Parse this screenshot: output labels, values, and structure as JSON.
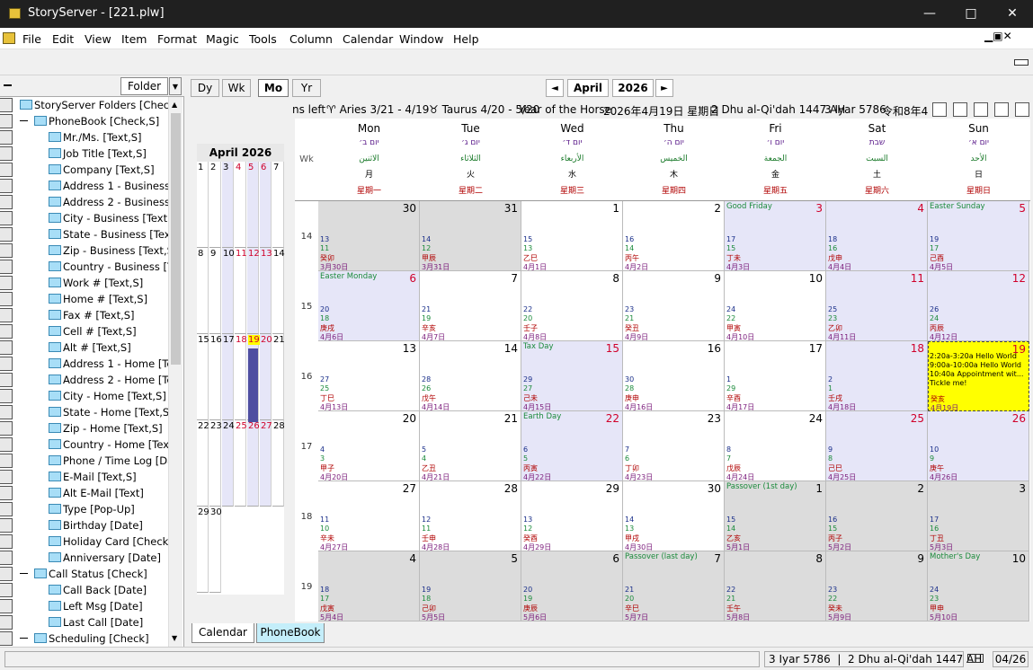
{
  "window": {
    "title": "StoryServer - [221.plw]"
  },
  "menu": [
    "File",
    "Edit",
    "View",
    "Item",
    "Format",
    "Magic",
    "Tools",
    "Column",
    "Calendar",
    "Window",
    "Help"
  ],
  "folder": {
    "header": "Folder",
    "items": [
      {
        "label": "StoryServer Folders [Check,S]",
        "level": 0,
        "minus": false
      },
      {
        "label": "PhoneBook [Check,S]",
        "level": 1,
        "minus": true
      },
      {
        "label": "Mr./Ms. [Text,S]",
        "level": 2
      },
      {
        "label": "Job Title [Text,S]",
        "level": 2
      },
      {
        "label": "Company [Text,S]",
        "level": 2
      },
      {
        "label": "Address 1 - Business [T",
        "level": 2
      },
      {
        "label": "Address 2 - Business [T",
        "level": 2
      },
      {
        "label": "City - Business [Text,S]",
        "level": 2
      },
      {
        "label": "State - Business [Text,S",
        "level": 2
      },
      {
        "label": "Zip - Business [Text,S]",
        "level": 2
      },
      {
        "label": "Country - Business [Tex",
        "level": 2
      },
      {
        "label": "Work # [Text,S]",
        "level": 2
      },
      {
        "label": "Home # [Text,S]",
        "level": 2
      },
      {
        "label": "Fax # [Text,S]",
        "level": 2
      },
      {
        "label": "Cell # [Text,S]",
        "level": 2
      },
      {
        "label": "Alt # [Text,S]",
        "level": 2
      },
      {
        "label": "Address 1 - Home [Text",
        "level": 2
      },
      {
        "label": "Address 2 - Home [Text",
        "level": 2
      },
      {
        "label": "City - Home [Text,S]",
        "level": 2
      },
      {
        "label": "State - Home [Text,S]",
        "level": 2
      },
      {
        "label": "Zip - Home [Text,S]",
        "level": 2
      },
      {
        "label": "Country - Home [Text,S]",
        "level": 2
      },
      {
        "label": "Phone / Time Log [Date,S",
        "level": 2
      },
      {
        "label": "E-Mail [Text,S]",
        "level": 2
      },
      {
        "label": "Alt E-Mail [Text]",
        "level": 2
      },
      {
        "label": "Type [Pop-Up]",
        "level": 2
      },
      {
        "label": "Birthday [Date]",
        "level": 2
      },
      {
        "label": "Holiday Card [Check]",
        "level": 2
      },
      {
        "label": "Anniversary [Date]",
        "level": 2
      },
      {
        "label": "Call Status [Check]",
        "level": 1,
        "minus": true
      },
      {
        "label": "Call Back [Date]",
        "level": 2
      },
      {
        "label": "Left Msg [Date]",
        "level": 2
      },
      {
        "label": "Last Call [Date]",
        "level": 2
      },
      {
        "label": "Scheduling [Check]",
        "level": 1,
        "minus": true
      }
    ]
  },
  "viewtabs": [
    "Dy",
    "Wk",
    "Mo",
    "Yr"
  ],
  "nav": {
    "month": "April",
    "year": "2026",
    "prev": "◄",
    "next": "►"
  },
  "infoline": {
    "left": "ns left",
    "aries": "♈ Aries 3/21 - 4/19",
    "taurus": "♉ Taurus 4/20 - 5/20",
    "horse": "Year of the Horse",
    "cn": "2026年4月19日 星期日",
    "hijri": "2 Dhu al-Qi'dah 1447 AH",
    "hebrew": "3 Iyar 5786",
    "jp": "令和8年4"
  },
  "mini": {
    "title": "April 2026",
    "rows": [
      [
        "1",
        "2",
        "3",
        "4",
        "5",
        "6",
        "7"
      ],
      [
        "8",
        "9",
        "10",
        "11",
        "12",
        "13",
        "14"
      ],
      [
        "15",
        "16",
        "17",
        "18",
        "19",
        "20",
        "21"
      ],
      [
        "22",
        "23",
        "24",
        "25",
        "26",
        "27",
        "28"
      ],
      [
        "29",
        "30",
        "",
        "",
        "",
        "",
        ""
      ]
    ]
  },
  "wk_label": "Wk",
  "weekdays": [
    {
      "en": "Mon",
      "heb": "יום ב׳",
      "ar": "الاثنين",
      "cn": "月",
      "cn2": "星期一"
    },
    {
      "en": "Tue",
      "heb": "יום ג׳",
      "ar": "الثلاثاء",
      "cn": "火",
      "cn2": "星期二"
    },
    {
      "en": "Wed",
      "heb": "יום ד׳",
      "ar": "الأربعاء",
      "cn": "水",
      "cn2": "星期三"
    },
    {
      "en": "Thu",
      "heb": "יום ה׳",
      "ar": "الخميس",
      "cn": "木",
      "cn2": "星期四"
    },
    {
      "en": "Fri",
      "heb": "יום ו׳",
      "ar": "الجمعة",
      "cn": "金",
      "cn2": "星期五"
    },
    {
      "en": "Sat",
      "heb": "שבת",
      "ar": "السبت",
      "cn": "土",
      "cn2": "星期六"
    },
    {
      "en": "Sun",
      "heb": "יום א׳",
      "ar": "الأحد",
      "cn": "日",
      "cn2": "星期日"
    }
  ],
  "weeks": [
    {
      "wk": "14",
      "days": [
        {
          "n": "30",
          "bg": "grey",
          "l1": "13",
          "l2": "11",
          "l3": "癸卯",
          "l4": "3月30日"
        },
        {
          "n": "31",
          "bg": "grey",
          "l1": "14",
          "l2": "12",
          "l3": "甲辰",
          "l4": "3月31日"
        },
        {
          "n": "1",
          "l1": "15",
          "l2": "13",
          "l3": "乙巳",
          "l4": "4月1日"
        },
        {
          "n": "2",
          "l1": "16",
          "l2": "14",
          "l3": "丙午",
          "l4": "4月2日"
        },
        {
          "n": "3",
          "bg": "blue",
          "red": true,
          "hol": "Good Friday",
          "l1": "17",
          "l2": "15",
          "l3": "丁未",
          "l4": "4月3日"
        },
        {
          "n": "4",
          "bg": "blue",
          "red": true,
          "l1": "18",
          "l2": "16",
          "l3": "戊申",
          "l4": "4月4日"
        },
        {
          "n": "5",
          "bg": "blue",
          "red": true,
          "hol": "Easter Sunday",
          "l1": "19",
          "l2": "17",
          "l3": "己酉",
          "l4": "4月5日"
        }
      ]
    },
    {
      "wk": "15",
      "days": [
        {
          "n": "6",
          "bg": "blue",
          "red": true,
          "hol": "Easter Monday",
          "l1": "20",
          "l2": "18",
          "l3": "庚戌",
          "l4": "4月6日"
        },
        {
          "n": "7",
          "l1": "21",
          "l2": "19",
          "l3": "辛亥",
          "l4": "4月7日"
        },
        {
          "n": "8",
          "l1": "22",
          "l2": "20",
          "l3": "壬子",
          "l4": "4月8日"
        },
        {
          "n": "9",
          "l1": "23",
          "l2": "21",
          "l3": "癸丑",
          "l4": "4月9日"
        },
        {
          "n": "10",
          "l1": "24",
          "l2": "22",
          "l3": "甲寅",
          "l4": "4月10日"
        },
        {
          "n": "11",
          "bg": "blue",
          "red": true,
          "l1": "25",
          "l2": "23",
          "l3": "乙卯",
          "l4": "4月11日"
        },
        {
          "n": "12",
          "bg": "blue",
          "red": true,
          "l1": "26",
          "l2": "24",
          "l3": "丙辰",
          "l4": "4月12日"
        }
      ]
    },
    {
      "wk": "16",
      "days": [
        {
          "n": "13",
          "l1": "27",
          "l2": "25",
          "l3": "丁巳",
          "l4": "4月13日"
        },
        {
          "n": "14",
          "l1": "28",
          "l2": "26",
          "l3": "戊午",
          "l4": "4月14日"
        },
        {
          "n": "15",
          "bg": "blue",
          "red": true,
          "hol": "Tax Day",
          "l1": "29",
          "l2": "27",
          "l3": "己未",
          "l4": "4月15日"
        },
        {
          "n": "16",
          "l1": "30",
          "l2": "28",
          "l3": "庚申",
          "l4": "4月16日"
        },
        {
          "n": "17",
          "l1": "1",
          "l2": "29",
          "l3": "辛酉",
          "l4": "4月17日"
        },
        {
          "n": "18",
          "bg": "blue",
          "red": true,
          "l1": "2",
          "l2": "1",
          "l3": "壬戌",
          "l4": "4月18日"
        },
        {
          "n": "19",
          "bg": "yellow",
          "red": true,
          "events": [
            "2:20a-3:20a Hello World",
            "9:00a-10:00a Hello World",
            "10:40a Appointment wit...",
            "Tickle me!"
          ],
          "l3": "癸亥",
          "l4": "4月19日"
        }
      ]
    },
    {
      "wk": "17",
      "days": [
        {
          "n": "20",
          "l1": "4",
          "l2": "3",
          "l3": "甲子",
          "l4": "4月20日"
        },
        {
          "n": "21",
          "l1": "5",
          "l2": "4",
          "l3": "乙丑",
          "l4": "4月21日"
        },
        {
          "n": "22",
          "bg": "blue",
          "red": true,
          "hol": "Earth Day",
          "l1": "6",
          "l2": "5",
          "l3": "丙寅",
          "l4": "4月22日"
        },
        {
          "n": "23",
          "l1": "7",
          "l2": "6",
          "l3": "丁卯",
          "l4": "4月23日"
        },
        {
          "n": "24",
          "l1": "8",
          "l2": "7",
          "l3": "戊辰",
          "l4": "4月24日"
        },
        {
          "n": "25",
          "bg": "blue",
          "red": true,
          "l1": "9",
          "l2": "8",
          "l3": "己巳",
          "l4": "4月25日"
        },
        {
          "n": "26",
          "bg": "blue",
          "red": true,
          "l1": "10",
          "l2": "9",
          "l3": "庚午",
          "l4": "4月26日"
        }
      ]
    },
    {
      "wk": "18",
      "days": [
        {
          "n": "27",
          "l1": "11",
          "l2": "10",
          "l3": "辛未",
          "l4": "4月27日"
        },
        {
          "n": "28",
          "l1": "12",
          "l2": "11",
          "l3": "壬申",
          "l4": "4月28日"
        },
        {
          "n": "29",
          "l1": "13",
          "l2": "12",
          "l3": "癸酉",
          "l4": "4月29日"
        },
        {
          "n": "30",
          "l1": "14",
          "l2": "13",
          "l3": "甲戌",
          "l4": "4月30日"
        },
        {
          "n": "1",
          "bg": "grey",
          "hol": "Passover (1st day)",
          "l1": "15",
          "l2": "14",
          "l3": "乙亥",
          "l4": "5月1日"
        },
        {
          "n": "2",
          "bg": "grey",
          "l1": "16",
          "l2": "15",
          "l3": "丙子",
          "l4": "5月2日"
        },
        {
          "n": "3",
          "bg": "grey",
          "l1": "17",
          "l2": "16",
          "l3": "丁丑",
          "l4": "5月3日"
        }
      ]
    },
    {
      "wk": "19",
      "days": [
        {
          "n": "4",
          "bg": "grey",
          "l1": "18",
          "l2": "17",
          "l3": "戊寅",
          "l4": "5月4日"
        },
        {
          "n": "5",
          "bg": "grey",
          "l1": "19",
          "l2": "18",
          "l3": "己卯",
          "l4": "5月5日"
        },
        {
          "n": "6",
          "bg": "grey",
          "l1": "20",
          "l2": "19",
          "l3": "庚辰",
          "l4": "5月6日"
        },
        {
          "n": "7",
          "bg": "grey",
          "hol": "Passover (last day)",
          "l1": "21",
          "l2": "20",
          "l3": "辛巳",
          "l4": "5月7日"
        },
        {
          "n": "8",
          "bg": "grey",
          "l1": "22",
          "l2": "21",
          "l3": "壬午",
          "l4": "5月8日"
        },
        {
          "n": "9",
          "bg": "grey",
          "l1": "23",
          "l2": "22",
          "l3": "癸未",
          "l4": "5月9日"
        },
        {
          "n": "10",
          "bg": "grey",
          "hol": "Mother's Day",
          "l1": "24",
          "l2": "23",
          "l3": "甲申",
          "l4": "5月10日"
        }
      ]
    }
  ],
  "bottomtabs": [
    "Calendar",
    "PhoneBook"
  ],
  "status": {
    "dates": "3 Iyar 5786  |  2 Dhu al-Qi'dah 1447 AH",
    "page": "04/26"
  },
  "colors": {
    "grey": "#dcdcdc",
    "blue": "#e6e6f8",
    "yellow": "#ffff00",
    "red": "#d0002a"
  }
}
